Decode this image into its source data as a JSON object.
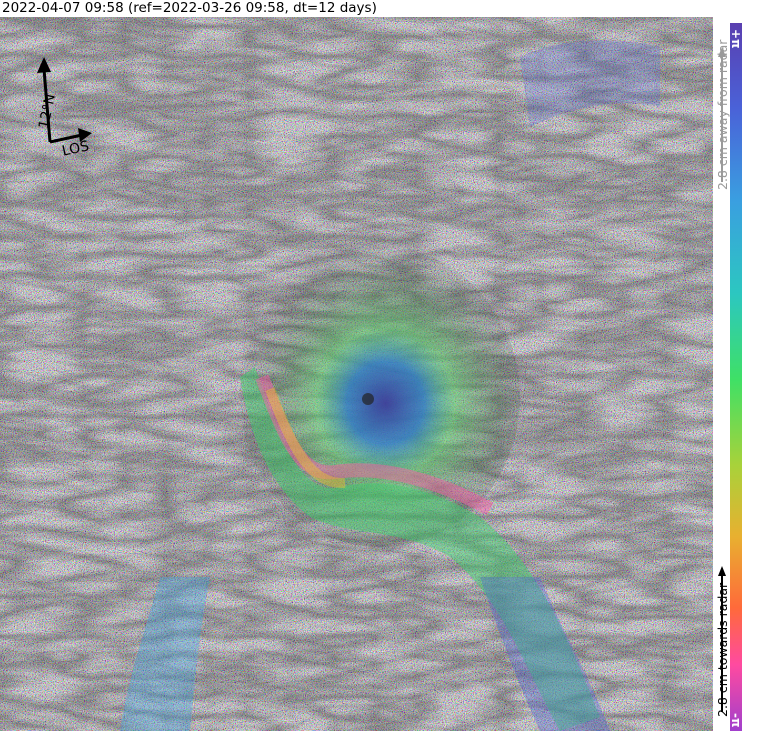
{
  "title": "2022-04-07 09:58 (ref=2022-03-26 09:58, dt=12 days)",
  "compass": {
    "north_label": "12°N",
    "los_label": "LOS"
  },
  "colorbar": {
    "top_label": "+π",
    "bottom_label": "-π",
    "away_label": "2.8 cm away from radar",
    "towards_label": "2.8 cm towards radar"
  },
  "colors": {
    "background": "#ffffff",
    "text": "#000000",
    "colorbar_gradient": [
      "#5a3fb0",
      "#4a62d8",
      "#3a9fe0",
      "#2cc7c0",
      "#3fe066",
      "#a8d23a",
      "#e8b030",
      "#ff6a3a",
      "#ff4aa0",
      "#9a3ed0"
    ]
  }
}
